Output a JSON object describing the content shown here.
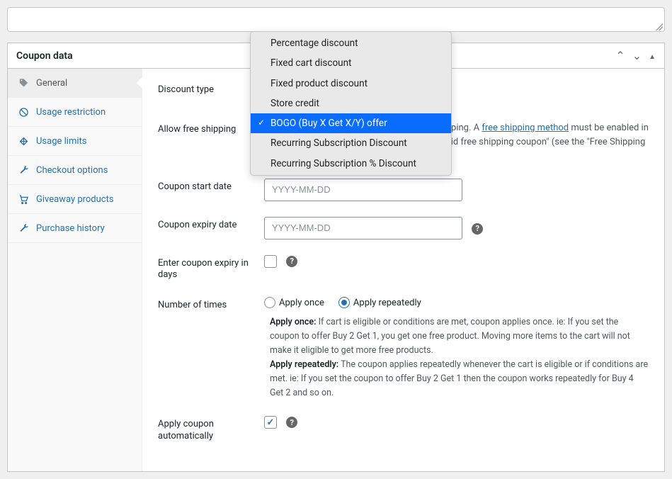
{
  "panel": {
    "title": "Coupon data"
  },
  "sidebar": {
    "items": [
      {
        "label": "General",
        "active": true
      },
      {
        "label": "Usage restriction"
      },
      {
        "label": "Usage limits"
      },
      {
        "label": "Checkout options"
      },
      {
        "label": "Giveaway products"
      },
      {
        "label": "Purchase history"
      }
    ]
  },
  "form": {
    "discount_type": {
      "label": "Discount type"
    },
    "free_shipping": {
      "label": "Allow free shipping",
      "info_prefix": "hipping. A ",
      "info_link": "free shipping method",
      "info_suffix": " must be enabled in your shipping zone and be set to require \"a valid free shipping coupon\" (see the \"Free Shipping Requires\" setting)."
    },
    "start_date": {
      "label": "Coupon start date",
      "placeholder": "YYYY-MM-DD"
    },
    "expiry_date": {
      "label": "Coupon expiry date",
      "placeholder": "YYYY-MM-DD"
    },
    "expiry_days": {
      "label": "Enter coupon expiry in days",
      "checked": false
    },
    "num_times": {
      "label": "Number of times",
      "option_once": "Apply once",
      "option_repeat": "Apply repeatedly",
      "desc_once_label": "Apply once:",
      "desc_once": " If cart is eligible or conditions are met, coupon applies once. ie: If you set the coupon to offer Buy 2 Get 1, you get one free product. Moving more items to the cart will not make it eligible to get more free products.",
      "desc_repeat_label": "Apply repeatedly:",
      "desc_repeat": " The coupon applies repeatedly whenever the cart is eligible or if conditions are met. ie: If you set the coupon to offer Buy 2 Get 1 then the coupon works repeatedly for Buy 4 Get 2 and so on."
    },
    "auto_apply": {
      "label": "Apply coupon automatically",
      "checked": true
    }
  },
  "dropdown": {
    "options": [
      "Percentage discount",
      "Fixed cart discount",
      "Fixed product discount",
      "Store credit",
      "BOGO (Buy X Get X/Y) offer",
      "Recurring Subscription Discount",
      "Recurring Subscription % Discount"
    ],
    "selected_index": 4
  }
}
